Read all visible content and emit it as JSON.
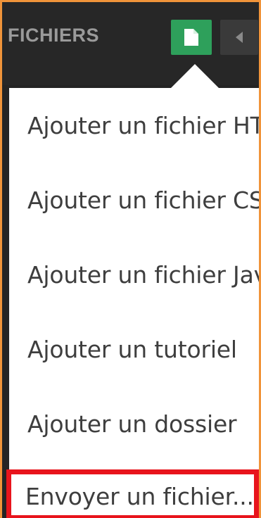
{
  "header": {
    "title": "FICHIERS",
    "new_file_icon": "file-icon",
    "collapse_icon": "caret-left-icon"
  },
  "menu": {
    "items": [
      {
        "label": "Ajouter un fichier HTML"
      },
      {
        "label": "Ajouter un fichier CSS"
      },
      {
        "label": "Ajouter un fichier JavaScript"
      },
      {
        "label": "Ajouter un tutoriel"
      },
      {
        "label": "Ajouter un dossier"
      }
    ],
    "upload_label": "Envoyer un fichier..."
  },
  "colors": {
    "accent_green": "#2ea05b",
    "frame_orange": "#f0943a",
    "highlight_red": "#e8141c",
    "header_bg": "#272727"
  }
}
